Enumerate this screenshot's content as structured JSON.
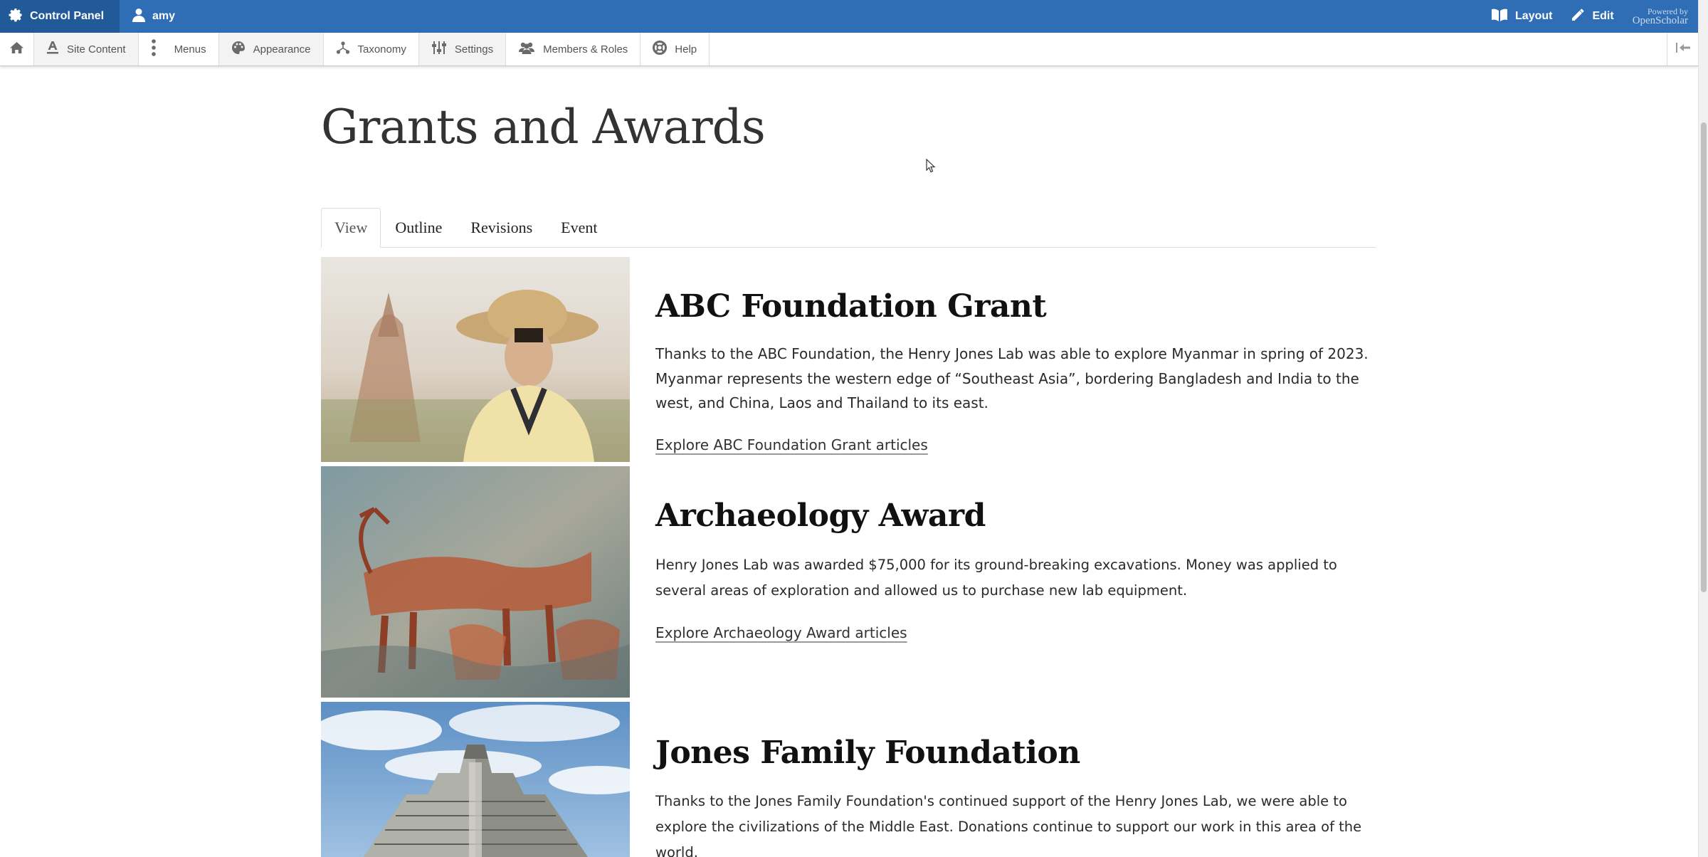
{
  "topbar": {
    "control_panel_label": "Control Panel",
    "user_label": "amy",
    "layout_label": "Layout",
    "edit_label": "Edit",
    "powered_by_label": "Powered by",
    "brand_label": "OpenScholar"
  },
  "toolbar": {
    "items": [
      {
        "label": "Site Content",
        "icon": "site-content-icon"
      },
      {
        "label": "Menus",
        "icon": "menus-icon"
      },
      {
        "label": "Appearance",
        "icon": "palette-icon"
      },
      {
        "label": "Taxonomy",
        "icon": "taxonomy-icon"
      },
      {
        "label": "Settings",
        "icon": "settings-icon"
      },
      {
        "label": "Members & Roles",
        "icon": "members-icon"
      },
      {
        "label": "Help",
        "icon": "help-icon"
      }
    ]
  },
  "page": {
    "title": "Grants and Awards",
    "tabs": [
      "View",
      "Outline",
      "Revisions",
      "Event"
    ],
    "active_tab": "View"
  },
  "entries": [
    {
      "title": "ABC Foundation Grant",
      "body": "Thanks to the ABC Foundation, the Henry Jones Lab was able to explore Myanmar in spring of 2023. Myanmar represents the western edge of “Southeast Asia”, bordering Bangladesh and India to the west, and China, Laos and Thailand to its east.",
      "link": "Explore ABC Foundation Grant articles"
    },
    {
      "title": "Archaeology Award",
      "body": "Henry Jones Lab was awarded $75,000 for its ground-breaking excavations. Money was applied to several areas of exploration and allowed us to purchase new lab equipment.",
      "link": "Explore Archaeology Award articles"
    },
    {
      "title": "Jones Family Foundation",
      "body": "Thanks to the Jones Family Foundation's continued support of the Henry Jones Lab, we were able to explore the civilizations of the Middle East. Donations continue to support our work in this area of the world."
    }
  ],
  "colors": {
    "topbar": "#2f6db5",
    "control_panel_bg": "#225a99",
    "text": "#222222"
  }
}
